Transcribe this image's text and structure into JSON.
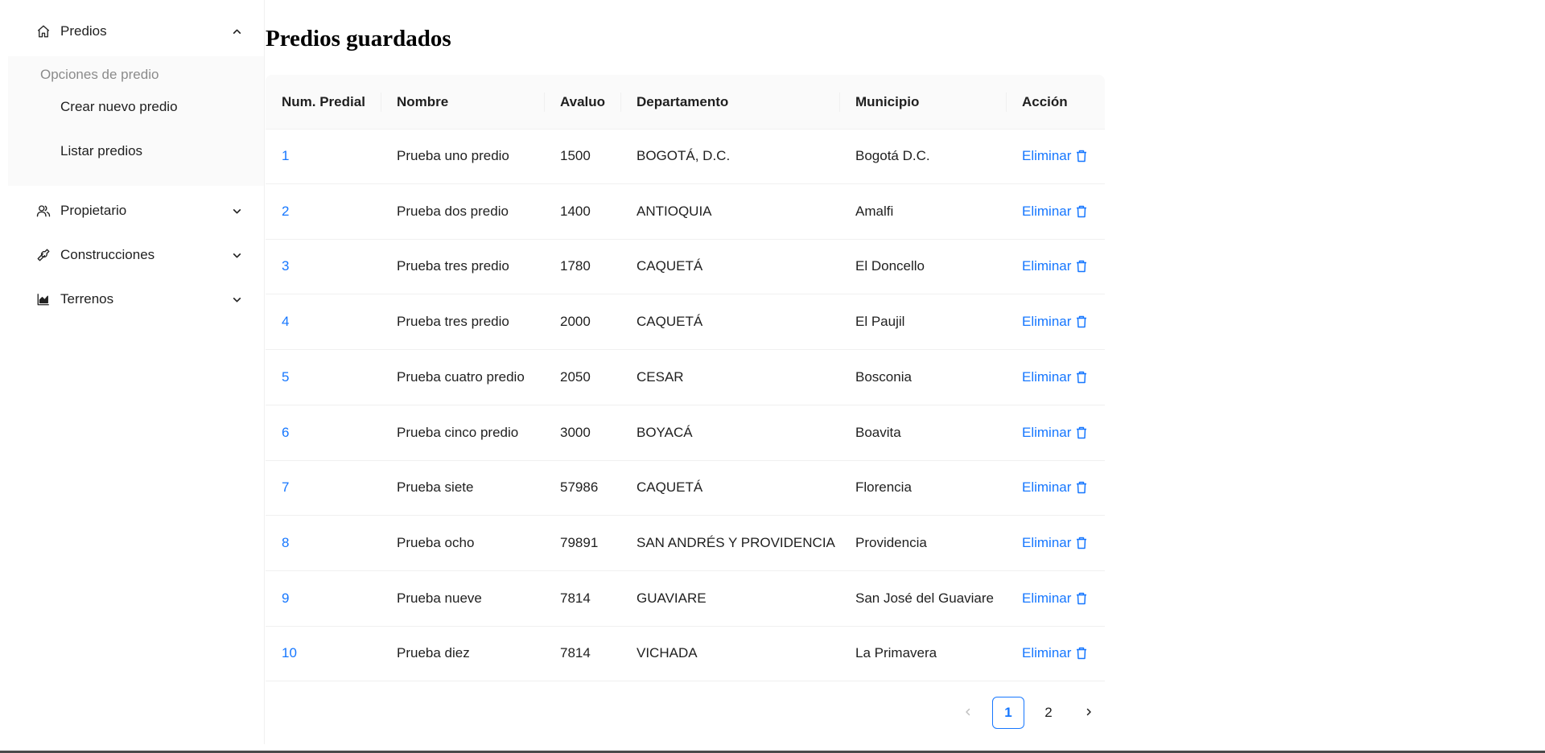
{
  "sidebar": {
    "predios_label": "Predios",
    "group_title": "Opciones de predio",
    "sub_items": [
      "Crear nuevo predio",
      "Listar predios"
    ],
    "propietario_label": "Propietario",
    "construcciones_label": "Construcciones",
    "terrenos_label": "Terrenos"
  },
  "main": {
    "title": "Predios guardados"
  },
  "table": {
    "headers": [
      "Num. Predial",
      "Nombre",
      "Avaluo",
      "Departamento",
      "Municipio",
      "Acción"
    ],
    "rows": [
      {
        "num": "1",
        "nombre": "Prueba uno predio",
        "avaluo": "1500",
        "departamento": "BOGOTÁ, D.C.",
        "municipio": "Bogotá D.C.",
        "accion": "Eliminar"
      },
      {
        "num": "2",
        "nombre": "Prueba dos predio",
        "avaluo": "1400",
        "departamento": "ANTIOQUIA",
        "municipio": "Amalfi",
        "accion": "Eliminar"
      },
      {
        "num": "3",
        "nombre": "Prueba tres predio",
        "avaluo": "1780",
        "departamento": "CAQUETÁ",
        "municipio": "El Doncello",
        "accion": "Eliminar"
      },
      {
        "num": "4",
        "nombre": "Prueba tres predio",
        "avaluo": "2000",
        "departamento": "CAQUETÁ",
        "municipio": "El Paujil",
        "accion": "Eliminar"
      },
      {
        "num": "5",
        "nombre": "Prueba cuatro predio",
        "avaluo": "2050",
        "departamento": "CESAR",
        "municipio": "Bosconia",
        "accion": "Eliminar"
      },
      {
        "num": "6",
        "nombre": "Prueba cinco predio",
        "avaluo": "3000",
        "departamento": "BOYACÁ",
        "municipio": "Boavita",
        "accion": "Eliminar"
      },
      {
        "num": "7",
        "nombre": "Prueba siete",
        "avaluo": "57986",
        "departamento": "CAQUETÁ",
        "municipio": "Florencia",
        "accion": "Eliminar"
      },
      {
        "num": "8",
        "nombre": "Prueba ocho",
        "avaluo": "79891",
        "departamento": "SAN ANDRÉS Y PROVIDENCIA",
        "municipio": "Providencia",
        "accion": "Eliminar"
      },
      {
        "num": "9",
        "nombre": "Prueba nueve",
        "avaluo": "7814",
        "departamento": "GUAVIARE",
        "municipio": "San José del Guaviare",
        "accion": "Eliminar"
      },
      {
        "num": "10",
        "nombre": "Prueba diez",
        "avaluo": "7814",
        "departamento": "VICHADA",
        "municipio": "La Primavera",
        "accion": "Eliminar"
      }
    ]
  },
  "pagination": {
    "pages": [
      "1",
      "2"
    ],
    "current": "1"
  },
  "colors": {
    "accent": "#1677ff",
    "header_bg": "#fafafa",
    "border": "#f0f0f0"
  },
  "icons": {
    "predios": "home-icon",
    "propietario": "users-icon",
    "construcciones": "tool-icon",
    "terrenos": "area-chart-icon",
    "delete": "trash-icon"
  }
}
